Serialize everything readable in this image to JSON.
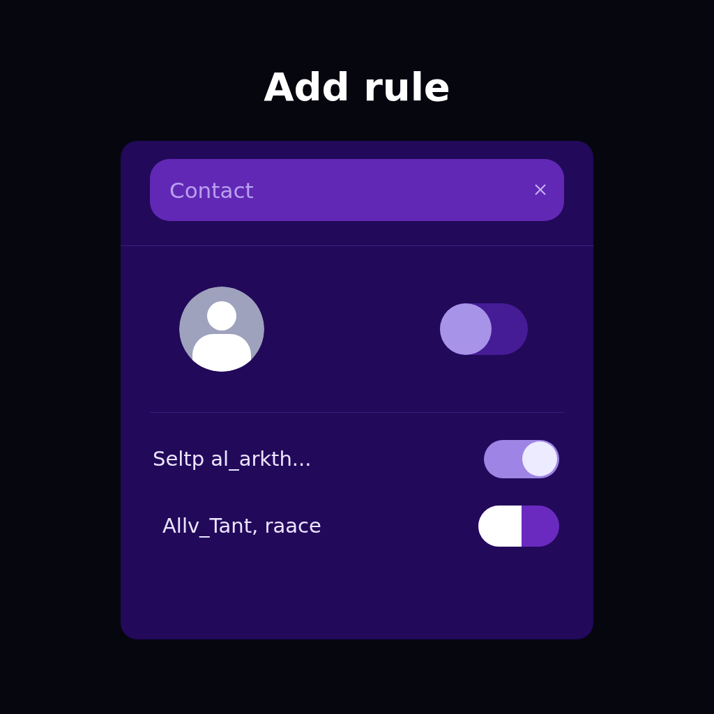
{
  "title": "Add rule",
  "search": {
    "placeholder": "Contact"
  },
  "contact": {
    "toggle": {
      "kind": "soft",
      "on": false
    }
  },
  "rows": [
    {
      "label": "Seltp al_arkth...",
      "toggle": {
        "kind": "light",
        "on": true
      }
    },
    {
      "label": "Allv_Tant, raace",
      "toggle": {
        "kind": "split",
        "on": false
      }
    }
  ]
}
